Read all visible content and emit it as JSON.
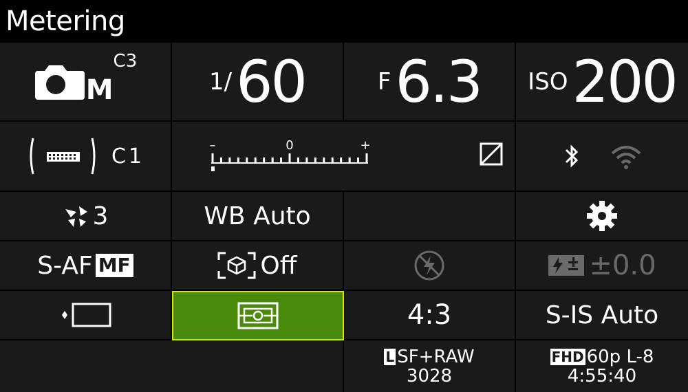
{
  "title": "Metering",
  "mode": {
    "letter": "M",
    "custom": "C3"
  },
  "shutter": {
    "prefix": "1/",
    "value": "60"
  },
  "aperture": {
    "prefix": "F",
    "value": "6.3"
  },
  "iso": {
    "prefix": "ISO",
    "value": "200"
  },
  "drive": {
    "custom": "C1"
  },
  "exposure": {
    "minus": "–",
    "zero": "0",
    "plus": "+"
  },
  "picture_mode": {
    "value": "3"
  },
  "wb": {
    "label": "WB Auto"
  },
  "af": {
    "mode": "S-AF",
    "mf": "MF"
  },
  "subject_detect": {
    "label": "Off"
  },
  "flash_comp": {
    "value": "±0.0"
  },
  "aspect": {
    "value": "4:3"
  },
  "stabilizer": {
    "value": "S-IS Auto"
  },
  "image_quality": {
    "line1": "SF+RAW",
    "line2": "3028"
  },
  "video": {
    "badge": "FHD",
    "format": "60p L-8",
    "remaining": "4:55:40"
  },
  "icons": {
    "mode": "camera-icon",
    "drive": "sequential-shooting-icon",
    "exposure_comp": "exposure-comp-icon",
    "bluetooth": "bluetooth-icon",
    "wifi": "wifi-icon",
    "picture_mode": "picture-mode-icon",
    "settings": "gear-icon",
    "subject": "subject-detection-icon",
    "flash": "flash-off-icon",
    "flash_comp": "flash-compensation-icon",
    "af_target": "af-target-icon",
    "metering": "metering-icon"
  },
  "colors": {
    "selected_bg": "#4a8a0b",
    "selected_border": "#d6e400",
    "panel_bg": "#1a1a1a"
  }
}
